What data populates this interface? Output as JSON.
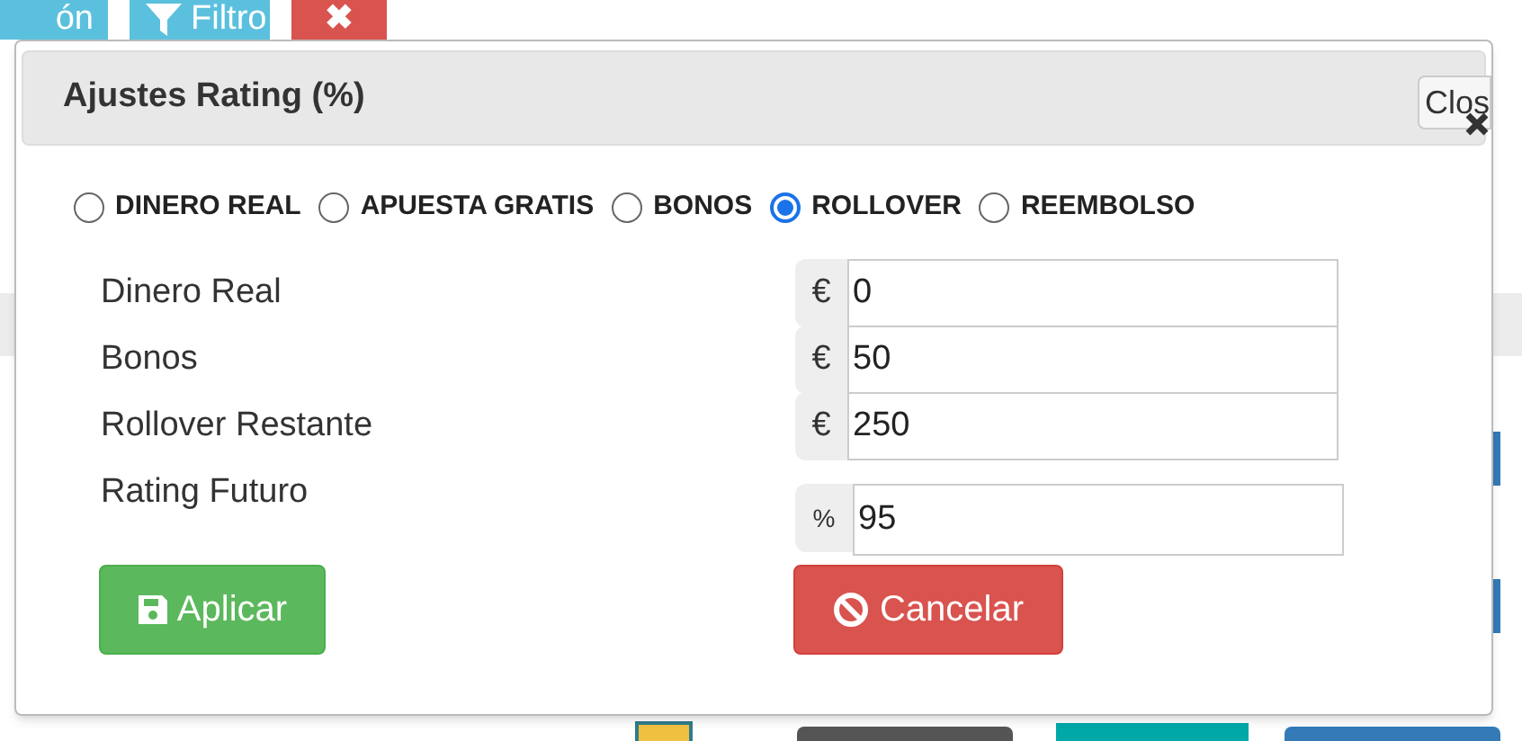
{
  "background_toolbar": [
    {
      "kind": "info",
      "label": "ón"
    },
    {
      "kind": "filter",
      "label": "Filtro"
    },
    {
      "kind": "clear",
      "label": "✖"
    }
  ],
  "dialog": {
    "title": "Ajustes Rating (%)",
    "close_button": "Clos",
    "modes": [
      {
        "label": "DINERO REAL",
        "selected": false
      },
      {
        "label": "APUESTA GRATIS",
        "selected": false
      },
      {
        "label": "BONOS",
        "selected": false
      },
      {
        "label": "ROLLOVER",
        "selected": true
      },
      {
        "label": "REEMBOLSO",
        "selected": false
      }
    ],
    "fields": [
      {
        "label": "Dinero Real",
        "unit": "€",
        "value": "0"
      },
      {
        "label": "Bonos",
        "unit": "€",
        "value": "50"
      },
      {
        "label": "Rollover Restante",
        "unit": "€",
        "value": "250"
      },
      {
        "label": "Rating Futuro",
        "unit": "%",
        "value": "95"
      }
    ],
    "buttons": [
      {
        "kind": "apply",
        "label": "Aplicar"
      },
      {
        "kind": "cancel",
        "label": "Cancelar"
      }
    ]
  }
}
